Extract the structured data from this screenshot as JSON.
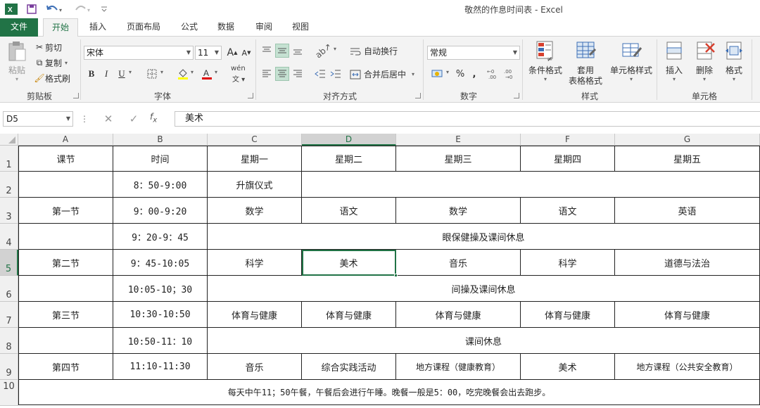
{
  "window": {
    "title": "敬然的作息时间表 - Excel"
  },
  "ribbon_tabs": [
    {
      "label": "文件"
    },
    {
      "label": "开始"
    },
    {
      "label": "插入"
    },
    {
      "label": "页面布局"
    },
    {
      "label": "公式"
    },
    {
      "label": "数据"
    },
    {
      "label": "审阅"
    },
    {
      "label": "视图"
    }
  ],
  "active_tab": "开始",
  "clipboard": {
    "paste": "粘贴",
    "cut": "剪切",
    "copy": "复制",
    "format_painter": "格式刷",
    "group": "剪贴板"
  },
  "font": {
    "name": "宋体",
    "size": "11",
    "group": "字体",
    "bold": "B",
    "italic": "I",
    "underline": "U",
    "wen": "wén",
    "grow": "A",
    "shrink": "A",
    "font_color_letter": "A"
  },
  "alignment": {
    "wrap": "自动换行",
    "merge": "合并后居中",
    "group": "对齐方式"
  },
  "number": {
    "format": "常规",
    "group": "数字",
    "percent": "%",
    "comma": ","
  },
  "styles": {
    "conditional": "条件格式",
    "table_format_1": "套用",
    "table_format_2": "表格格式",
    "cell_styles": "单元格样式",
    "group": "样式"
  },
  "cells": {
    "insert": "插入",
    "delete": "删除",
    "format": "格式",
    "group": "单元格"
  },
  "formula_bar": {
    "name_box": "D5",
    "content": "美术"
  },
  "accent_color": "#217346",
  "columns": [
    {
      "label": "A"
    },
    {
      "label": "B"
    },
    {
      "label": "C"
    },
    {
      "label": "D"
    },
    {
      "label": "E"
    },
    {
      "label": "F"
    },
    {
      "label": "G"
    }
  ],
  "row_headers": [
    "1",
    "2",
    "3",
    "4",
    "5",
    "6",
    "7",
    "8",
    "9",
    "10"
  ],
  "timetable": {
    "header": [
      "课节",
      "时间",
      "星期一",
      "星期二",
      "星期三",
      "星期四",
      "星期五"
    ],
    "row2": {
      "time": "8：50-9:00",
      "monday": "升旗仪式"
    },
    "row3": {
      "period": "第一节",
      "time": "9：00-9:20",
      "days": [
        "数学",
        "语文",
        "数学",
        "语文",
        "英语"
      ]
    },
    "row4": {
      "time": "9：20-9：45",
      "merged": "眼保健操及课间休息"
    },
    "row5": {
      "period": "第二节",
      "time": "9：45-10:05",
      "days": [
        "科学",
        "美术",
        "音乐",
        "科学",
        "道德与法治"
      ]
    },
    "row6": {
      "time": "10:05-10；30",
      "merged": "间操及课间休息"
    },
    "row7": {
      "period": "第三节",
      "time": "10:30-10:50",
      "days": [
        "体育与健康",
        "体育与健康",
        "体育与健康",
        "体育与健康",
        "体育与健康"
      ]
    },
    "row8": {
      "time": "10:50-11：10",
      "merged": "课间休息"
    },
    "row9": {
      "period": "第四节",
      "time": "11:10-11:30",
      "days": [
        "音乐",
        "综合实践活动",
        "地方课程（健康教育）",
        "美术",
        "地方课程（公共安全教育）"
      ]
    },
    "row10": {
      "note": "每天中午11；50午餐，午餐后会进行午睡。晚餐一般是5：00，吃完晚餐会出去跑步。"
    }
  }
}
